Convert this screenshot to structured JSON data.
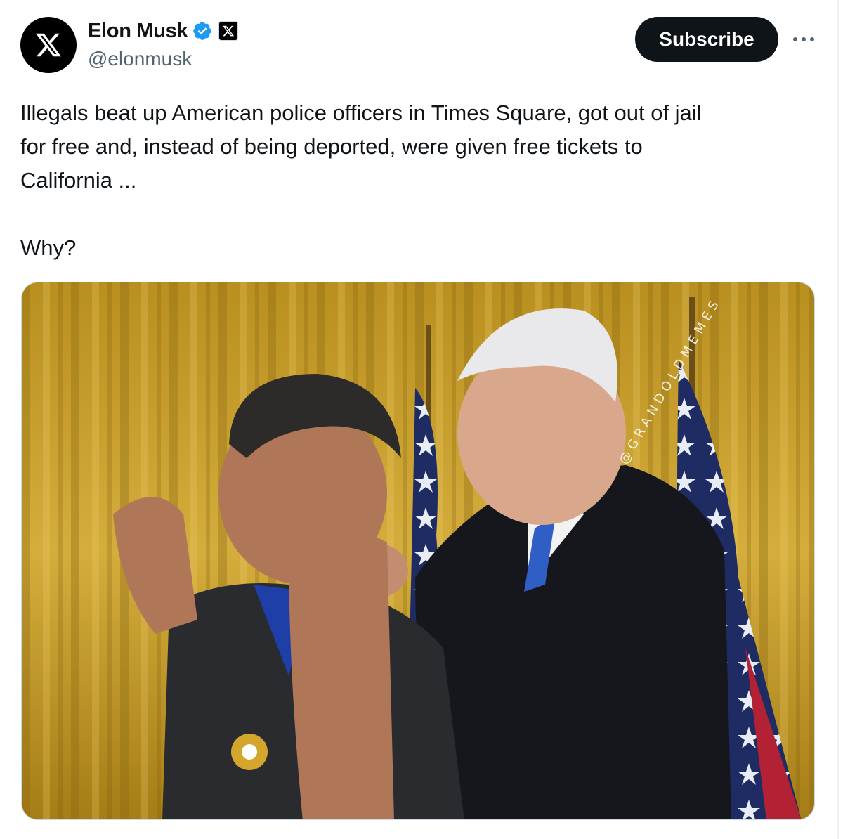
{
  "author": {
    "display_name": "Elon Musk",
    "handle": "@elonmusk",
    "verified": true,
    "affiliation_badge": "x-logo-icon",
    "avatar_icon": "x-logo-icon"
  },
  "actions": {
    "subscribe_label": "Subscribe",
    "more_icon": "more-horizontal-icon"
  },
  "tweet": {
    "text": "Illegals beat up American police officers in Times Square, got out of jail\nfor free and, instead of being deported, were given free tickets to\nCalifornia ...\n\nWhy?"
  },
  "media": {
    "watermark_text": "@GRANDOLDMEMES"
  },
  "colors": {
    "text_primary": "#0f1419",
    "text_secondary": "#536471",
    "verified_blue": "#1d9bf0",
    "button_bg": "#0f1419",
    "border": "#cfd9de",
    "curtain_gold": "#c9a12f"
  }
}
